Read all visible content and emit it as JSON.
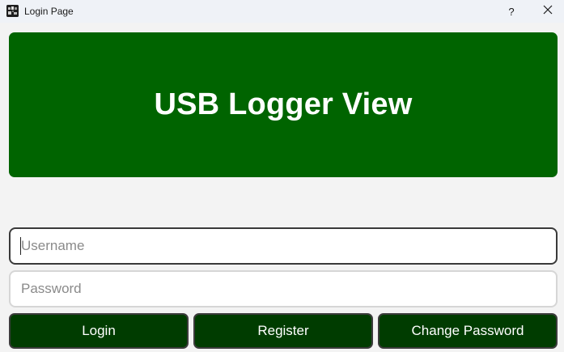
{
  "window": {
    "title": "Login Page",
    "app_icon": "app-logo-icon",
    "help_label": "?",
    "close_icon": "close-icon"
  },
  "banner": {
    "title": "USB Logger View",
    "background_color": "#006400",
    "text_color": "#ffffff"
  },
  "form": {
    "username": {
      "value": "",
      "placeholder": "Username"
    },
    "password": {
      "value": "",
      "placeholder": "Password"
    }
  },
  "buttons": {
    "login_label": "Login",
    "register_label": "Register",
    "change_password_label": "Change Password",
    "background_color": "#003c00"
  }
}
